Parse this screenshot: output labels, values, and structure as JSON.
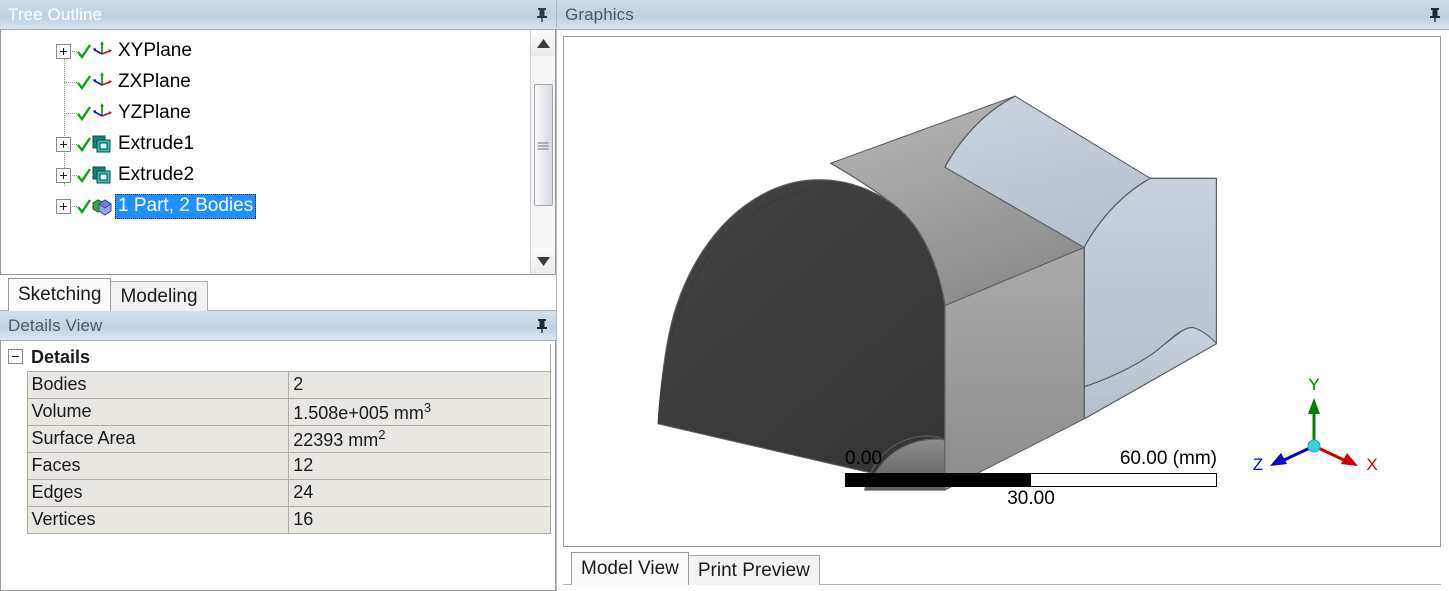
{
  "tree_panel": {
    "title": "Tree Outline",
    "pin_icon": "pin-icon",
    "items": [
      {
        "label": "XYPlane",
        "icon": "plane-axes-icon",
        "expandable": true,
        "checked": true,
        "selected": false
      },
      {
        "label": "ZXPlane",
        "icon": "plane-axes-icon",
        "expandable": false,
        "checked": true,
        "selected": false
      },
      {
        "label": "YZPlane",
        "icon": "plane-axes-icon",
        "expandable": false,
        "checked": true,
        "selected": false
      },
      {
        "label": "Extrude1",
        "icon": "extrude-icon",
        "expandable": true,
        "checked": true,
        "selected": false
      },
      {
        "label": "Extrude2",
        "icon": "extrude-icon",
        "expandable": true,
        "checked": true,
        "selected": false
      },
      {
        "label": "1 Part, 2 Bodies",
        "icon": "part-bodies-icon",
        "expandable": true,
        "checked": true,
        "selected": true
      }
    ],
    "scrollbar": {
      "up_icon": "scroll-up-arrow-icon",
      "down_icon": "scroll-down-arrow-icon",
      "grip_icon": "scroll-thumb-grip-icon"
    },
    "selection_color": "#1e90ff"
  },
  "left_tabs": [
    {
      "label": "Sketching",
      "active": true
    },
    {
      "label": "Modeling",
      "active": false
    }
  ],
  "details_panel": {
    "title": "Details View",
    "pin_icon": "pin-icon",
    "group_label": "Details",
    "collapse_icon": "minus-collapse-icon",
    "rows": [
      {
        "label": "Bodies",
        "value": "2"
      },
      {
        "label": "Volume",
        "value": "1.508e+005 mm",
        "sup": "3"
      },
      {
        "label": "Surface Area",
        "value": "22393 mm",
        "sup": "2"
      },
      {
        "label": "Faces",
        "value": "12"
      },
      {
        "label": "Edges",
        "value": "24"
      },
      {
        "label": "Vertices",
        "value": "16"
      }
    ]
  },
  "graphics_panel": {
    "title": "Graphics",
    "pin_icon": "pin-icon",
    "scale_bar": {
      "min": "0.00",
      "mid": "30.00",
      "max": "60.00 (mm)"
    },
    "triad": {
      "x_label": "X",
      "y_label": "Y",
      "z_label": "Z",
      "x_color": "#cc0000",
      "y_color": "#008000",
      "z_color": "#0000cc",
      "origin_color": "#34d6d6"
    },
    "model": {
      "near_body_color": "#3d3d3d",
      "near_body_top_color": "#9a9a9a",
      "far_body_color": "#c2cbd6",
      "edge_color": "#5a6068"
    }
  },
  "graphics_tabs": [
    {
      "label": "Model View",
      "active": true
    },
    {
      "label": "Print Preview",
      "active": false
    }
  ]
}
